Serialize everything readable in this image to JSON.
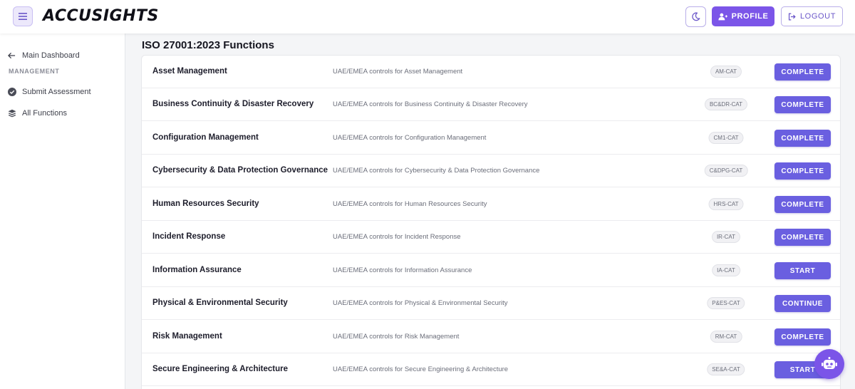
{
  "header": {
    "brand": "ACCUSIGHTS",
    "profile_label": "PROFILE",
    "logout_label": "LOGOUT"
  },
  "sidebar": {
    "back_label": "Main Dashboard",
    "section_label": "MANAGEMENT",
    "items": [
      {
        "label": "Submit Assessment",
        "icon": "check-circle-icon"
      },
      {
        "label": "All Functions",
        "icon": "layers-icon"
      }
    ]
  },
  "main": {
    "title": "ISO 27001:2023 Functions",
    "rows": [
      {
        "name": "Asset Management",
        "desc": "UAE/EMEA controls for Asset Management",
        "code": "AM-CAT",
        "action": "COMPLETE"
      },
      {
        "name": "Business Continuity & Disaster Recovery",
        "desc": "UAE/EMEA controls for Business Continuity & Disaster Recovery",
        "code": "BC&DR-CAT",
        "action": "COMPLETE"
      },
      {
        "name": "Configuration Management",
        "desc": "UAE/EMEA controls for Configuration Management",
        "code": "CM1-CAT",
        "action": "COMPLETE"
      },
      {
        "name": "Cybersecurity & Data Protection Governance",
        "desc": "UAE/EMEA controls for Cybersecurity & Data Protection Governance",
        "code": "C&DPG-CAT",
        "action": "COMPLETE"
      },
      {
        "name": "Human Resources Security",
        "desc": "UAE/EMEA controls for Human Resources Security",
        "code": "HRS-CAT",
        "action": "COMPLETE"
      },
      {
        "name": "Incident Response",
        "desc": "UAE/EMEA controls for Incident Response",
        "code": "IR-CAT",
        "action": "COMPLETE"
      },
      {
        "name": "Information Assurance",
        "desc": "UAE/EMEA controls for Information Assurance",
        "code": "IA-CAT",
        "action": "START"
      },
      {
        "name": "Physical & Environmental Security",
        "desc": "UAE/EMEA controls for Physical & Environmental Security",
        "code": "P&ES-CAT",
        "action": "CONTINUE"
      },
      {
        "name": "Risk Management",
        "desc": "UAE/EMEA controls for Risk Management",
        "code": "RM-CAT",
        "action": "COMPLETE"
      },
      {
        "name": "Secure Engineering & Architecture",
        "desc": "UAE/EMEA controls for Secure Engineering & Architecture",
        "code": "SE&A-CAT",
        "action": "START"
      }
    ]
  },
  "colors": {
    "accent": "#7b55e8",
    "action_button": "#6a5fe0"
  }
}
